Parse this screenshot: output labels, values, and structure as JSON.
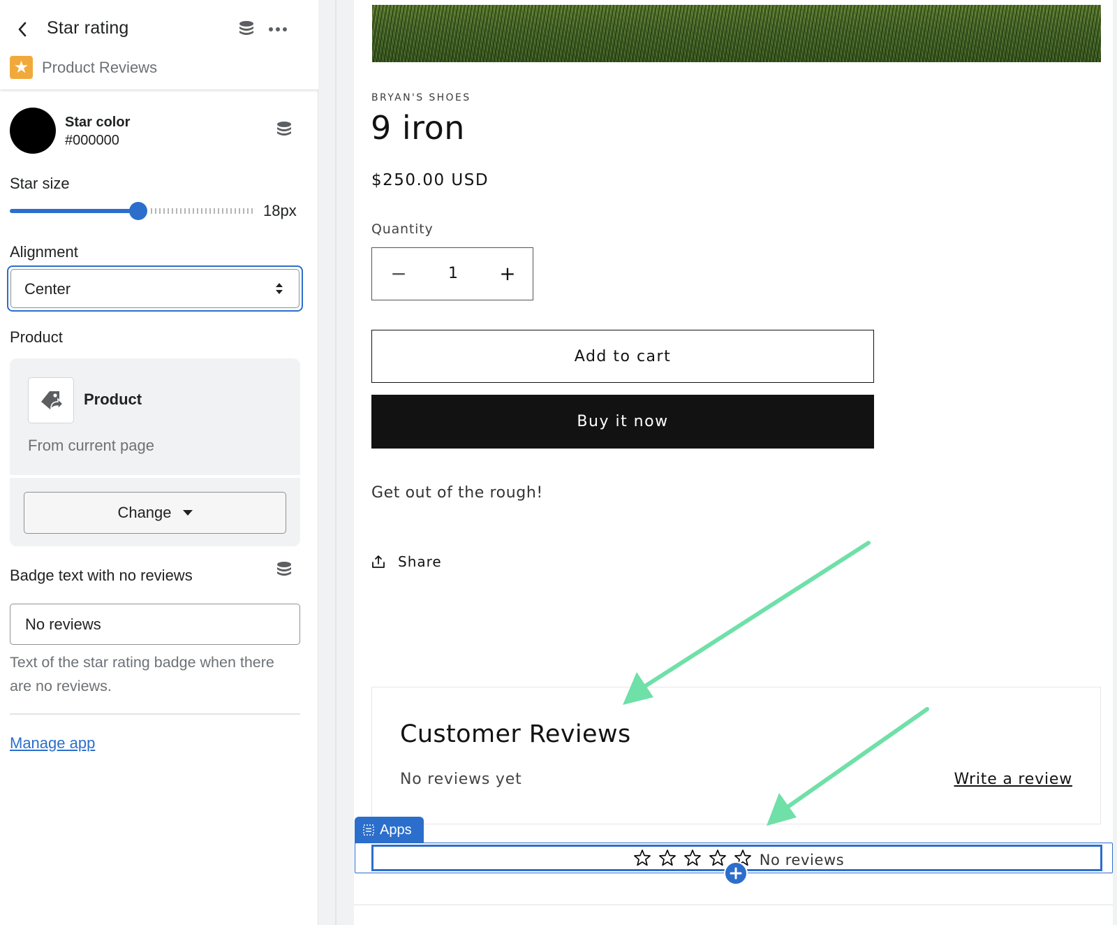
{
  "panel": {
    "title": "Star rating",
    "app_name": "Product Reviews",
    "icons": {
      "back": "chevron-left-icon",
      "database": "database-icon",
      "more": "more-horizontal-icon",
      "app_logo": "star-icon"
    },
    "star_color": {
      "label": "Star color",
      "value": "#000000"
    },
    "star_size": {
      "label": "Star size",
      "value_text": "18px",
      "fraction": 0.53
    },
    "alignment": {
      "label": "Alignment",
      "selected": "Center"
    },
    "product": {
      "label": "Product",
      "name": "Product",
      "source": "From current page",
      "change_label": "Change"
    },
    "badge": {
      "label": "Badge text with no reviews",
      "value": "No reviews",
      "help": "Text of the star rating badge when there are no reviews."
    },
    "manage_link": "Manage app"
  },
  "preview": {
    "vendor": "BRYAN'S SHOES",
    "title": "9 iron",
    "price": "$250.00 USD",
    "quantity_label": "Quantity",
    "quantity_value": "1",
    "qty_minus": "−",
    "qty_plus": "+",
    "add_to_cart": "Add to cart",
    "buy_now": "Buy it now",
    "description": "Get out of the rough!",
    "share": "Share",
    "reviews": {
      "title": "Customer Reviews",
      "empty": "No reviews yet",
      "write": "Write a review"
    },
    "apps_tag": "Apps",
    "rating_block": {
      "stars_filled": 0,
      "stars_total": 5,
      "text": "No reviews"
    }
  },
  "colors": {
    "accent": "#2c6ecb",
    "app_logo": "#f2a93b",
    "arrow": "#6fe0a8",
    "buy_button": "#121212"
  }
}
